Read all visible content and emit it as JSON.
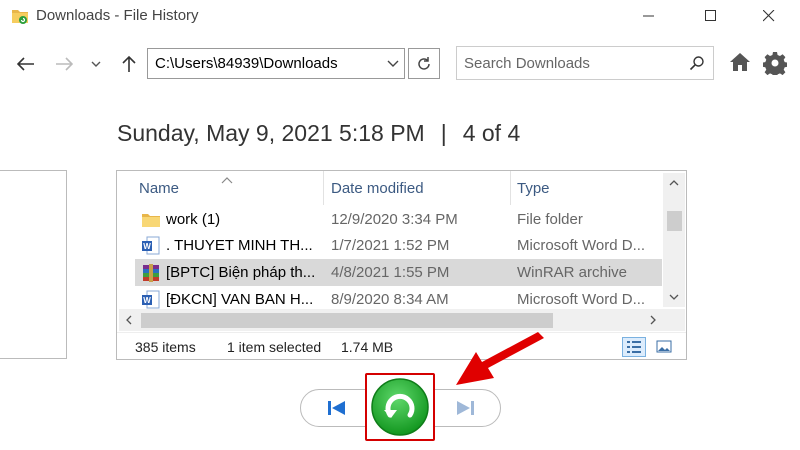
{
  "window": {
    "title": "Downloads - File History"
  },
  "address": {
    "path": "C:\\Users\\84939\\Downloads"
  },
  "search": {
    "placeholder": "Search Downloads"
  },
  "snapshot": {
    "datetime": "Sunday, May 9, 2021 5:18 PM",
    "separator": "|",
    "position": "4 of 4"
  },
  "file_list": {
    "columns": [
      "Name",
      "Date modified",
      "Type"
    ],
    "rows": [
      {
        "name": "work (1)",
        "date": "12/9/2020 3:34 PM",
        "type": "File folder",
        "icon": "folder-icon"
      },
      {
        "name": ". THUYET MINH TH...",
        "date": "1/7/2021 1:52 PM",
        "type": "Microsoft Word D...",
        "icon": "word-doc-icon"
      },
      {
        "name": "[BPTC] Biện pháp th...",
        "date": "4/8/2021 1:55 PM",
        "type": "WinRAR archive",
        "icon": "winrar-archive-icon",
        "selected": true
      },
      {
        "name": "[ĐKCN] VAN BAN H...",
        "date": "8/9/2020 8:34 AM",
        "type": "Microsoft Word D...",
        "icon": "word-doc-icon"
      }
    ]
  },
  "status_bar": {
    "item_count": "385 items",
    "selection": "1 item selected",
    "size": "1.74 MB"
  },
  "colors": {
    "restore_green": "#1aa82e",
    "highlight_red": "#d40000",
    "selected_row": "#d9d9d9",
    "header_text": "#3c5a82",
    "nav_blue": "#1f6fd1"
  }
}
